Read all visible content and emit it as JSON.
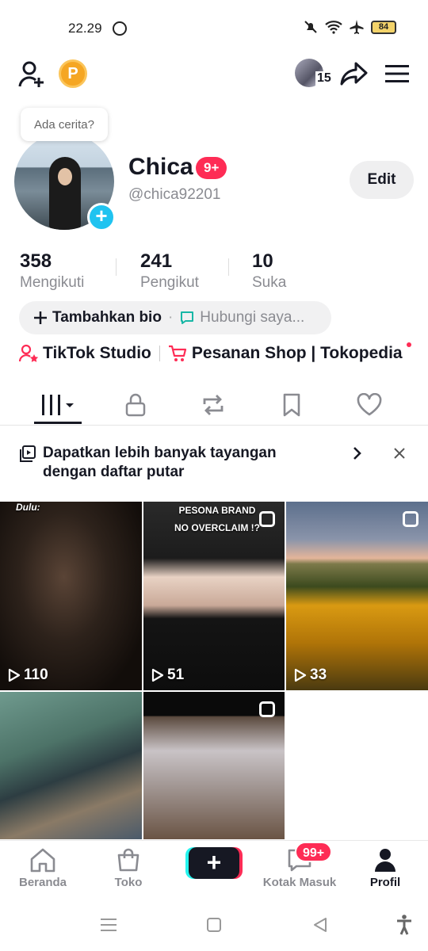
{
  "status_bar": {
    "time": "22.29",
    "battery": "84"
  },
  "top_bar": {
    "coin_label": "P",
    "friends_count": "15"
  },
  "profile": {
    "story_prompt": "Ada cerita?",
    "name": "Chica",
    "name_badge": "9+",
    "handle": "@chica92201",
    "edit_label": "Edit"
  },
  "stats": [
    {
      "value": "358",
      "label": "Mengikuti"
    },
    {
      "value": "241",
      "label": "Pengikut"
    },
    {
      "value": "10",
      "label": "Suka"
    }
  ],
  "bio": {
    "add_label": "Tambahkan bio",
    "separator": "·",
    "contact_label": "Hubungi saya..."
  },
  "links": {
    "studio": "TikTok Studio",
    "shop": "Pesanan Shop | Tokopedia"
  },
  "playlist_banner": {
    "text": "Dapatkan lebih banyak tayangan dengan daftar putar"
  },
  "videos": [
    {
      "views": "110",
      "overlay": "Dulu:"
    },
    {
      "views": "51",
      "overlay": "PESONA BRAND NO OVERCLAIM !?"
    },
    {
      "views": "33",
      "overlay": ""
    },
    {
      "views": "",
      "overlay": ""
    },
    {
      "views": "",
      "overlay": ""
    }
  ],
  "bottom_nav": {
    "home": "Beranda",
    "shop": "Toko",
    "inbox": "Kotak Masuk",
    "inbox_badge": "99+",
    "profile": "Profil",
    "create": "+"
  },
  "colors": {
    "accent": "#fe2c55",
    "cyan": "#25f4ee",
    "story_add": "#20c3f0",
    "coin": "#f5a623"
  }
}
